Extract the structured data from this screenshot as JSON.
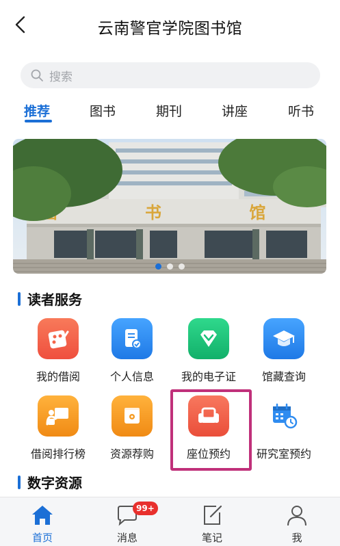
{
  "header": {
    "title": "云南警官学院图书馆"
  },
  "search": {
    "placeholder": "搜索"
  },
  "tabs": [
    {
      "label": "推荐",
      "active": true
    },
    {
      "label": "图书"
    },
    {
      "label": "期刊"
    },
    {
      "label": "讲座"
    },
    {
      "label": "听书"
    }
  ],
  "banner": {
    "sign_text": "图 书 馆",
    "slides": 3,
    "active_slide": 1
  },
  "reader_services": {
    "title": "读者服务",
    "items": [
      {
        "label": "我的借阅",
        "icon": "palette-icon",
        "color": "#f4664a"
      },
      {
        "label": "个人信息",
        "icon": "profile-card-icon",
        "color": "#2f8cf0"
      },
      {
        "label": "我的电子证",
        "icon": "diamond-icon",
        "color": "#19c27a"
      },
      {
        "label": "馆藏查询",
        "icon": "graduation-cap-icon",
        "color": "#2f8cf0"
      },
      {
        "label": "借阅排行榜",
        "icon": "presenter-board-icon",
        "color": "#f59b22"
      },
      {
        "label": "资源荐购",
        "icon": "recommend-box-icon",
        "color": "#f59b22"
      },
      {
        "label": "座位预约",
        "icon": "armchair-icon",
        "color": "#f0624b"
      },
      {
        "label": "研究室预约",
        "icon": "calendar-clock-icon",
        "color": "#2f8cf0"
      }
    ]
  },
  "digital_resources": {
    "title": "数字资源"
  },
  "tabbar": [
    {
      "label": "首页",
      "icon": "home-icon",
      "active": true
    },
    {
      "label": "消息",
      "icon": "message-icon",
      "badge": "99+"
    },
    {
      "label": "笔记",
      "icon": "note-edit-icon"
    },
    {
      "label": "我",
      "icon": "user-icon"
    }
  ],
  "colors": {
    "accent": "#1b6fd6",
    "highlight": "#c0307a",
    "badge": "#e8302d"
  }
}
